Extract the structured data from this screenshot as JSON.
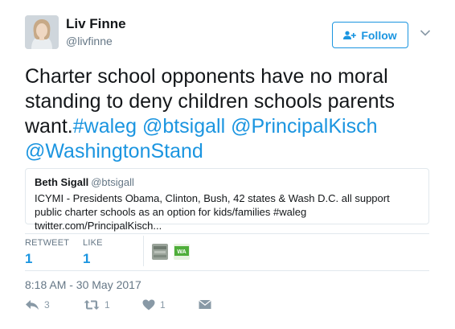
{
  "author": {
    "name": "Liv Finne",
    "handle": "@livfinne"
  },
  "follow_button": {
    "label": "Follow",
    "icon": "add-user-icon"
  },
  "tweet": {
    "text_plain": "Charter school opponents have no moral standing to deny children schools parents want.",
    "links": [
      "#waleg",
      "@btsigall",
      "@PrincipalKisch",
      "@WashingtonStand"
    ]
  },
  "quoted_tweet": {
    "name": "Beth Sigall",
    "handle": "@btsigall",
    "text": "ICYMI - Presidents Obama, Clinton, Bush, 42 states & Wash D.C. all support public charter schools as an option for kids/families #waleg twitter.com/PrincipalKisch..."
  },
  "stats": {
    "retweet_label": "RETWEET",
    "retweet_count": "1",
    "like_label": "LIKE",
    "like_count": "1",
    "liker_avatars": [
      "avatar-1",
      "avatar-2"
    ]
  },
  "timestamp": "8:18 AM - 30 May 2017",
  "actions": {
    "reply_count": "3",
    "retweet_count": "1",
    "like_count": "1"
  },
  "colors": {
    "link": "#1b95e0",
    "muted": "#657786",
    "icon": "#8899a6",
    "border": "#e1e8ed"
  }
}
